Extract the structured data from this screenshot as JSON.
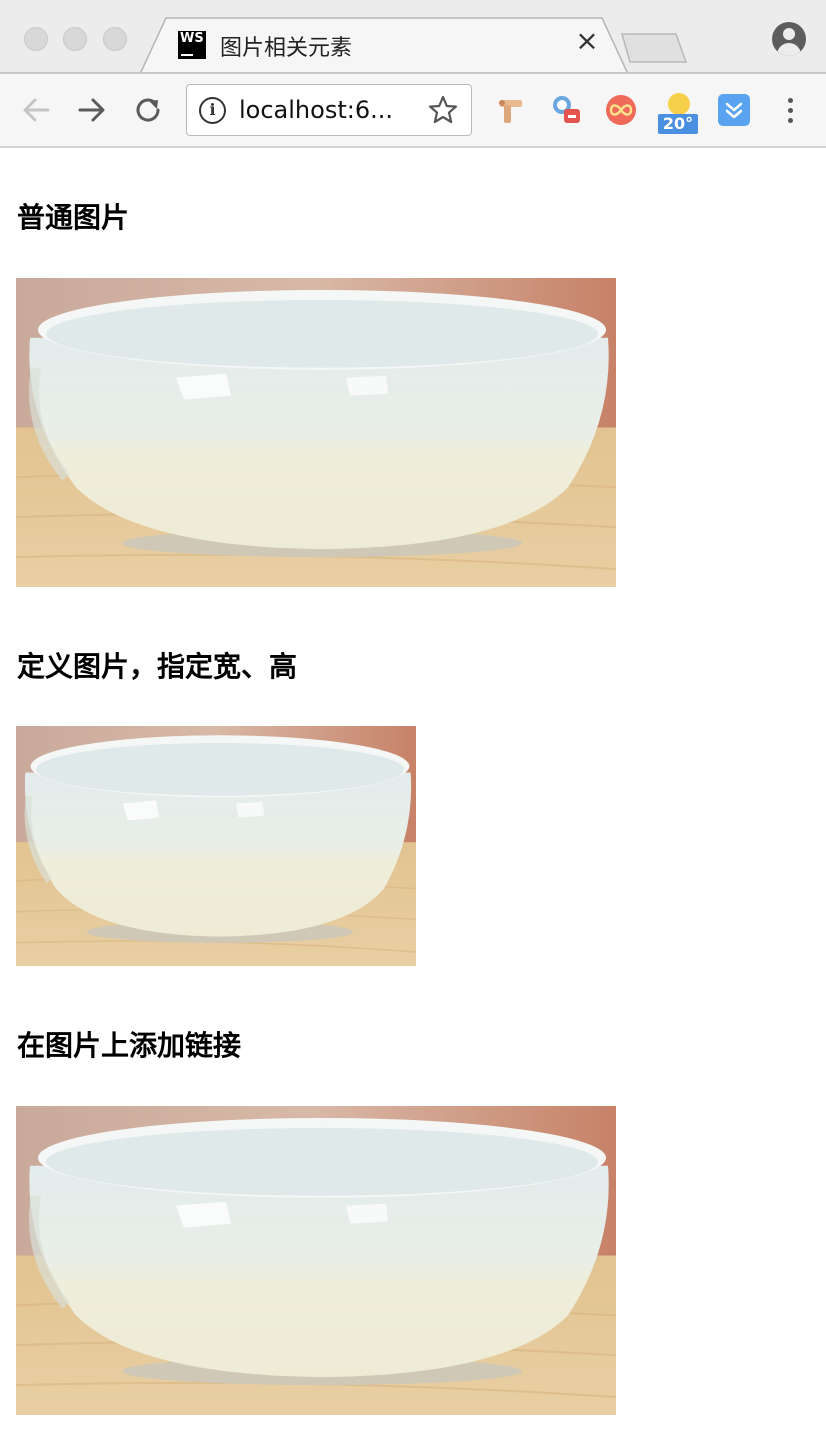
{
  "browser": {
    "tab": {
      "favicon_label": "WS",
      "title": "图片相关元素",
      "close_label": "×"
    },
    "address_bar": {
      "info_icon": "info-icon",
      "url": "localhost:6..."
    },
    "icons": {
      "back": "back-arrow-icon",
      "forward": "forward-arrow-icon",
      "reload": "reload-icon",
      "bookmark": "star-icon",
      "profile": "profile-icon",
      "menu": "kebab-menu-icon"
    },
    "extensions": {
      "weather_badge": "20°"
    }
  },
  "page": {
    "sections": [
      {
        "heading": "普通图片",
        "image": {
          "subject": "white-ceramic-bowl"
        }
      },
      {
        "heading": "定义图片，指定宽、高",
        "image": {
          "subject": "white-ceramic-bowl"
        }
      },
      {
        "heading": "在图片上添加链接",
        "image": {
          "subject": "white-ceramic-bowl",
          "is_link": true
        }
      }
    ]
  },
  "colors": {
    "chrome_background": "#ececec",
    "toolbar_background": "#f6f6f6",
    "page_background": "#ffffff",
    "bowl_glaze": "#e9efe7",
    "wood_table": "#e4c696",
    "photo_backdrop": "#c89a86"
  }
}
